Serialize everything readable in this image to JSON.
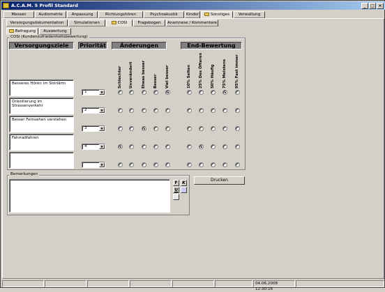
{
  "window": {
    "title": "A.C.A.M. 5 Profil Standard"
  },
  "main_tabs": [
    {
      "label": "Messen"
    },
    {
      "label": "Audiometrie"
    },
    {
      "label": "Anpassung"
    },
    {
      "label": "Richtungshören"
    },
    {
      "label": "Psychoakustik"
    },
    {
      "label": "Kinder"
    },
    {
      "label": "Sonstiges"
    },
    {
      "label": "Verwaltung"
    }
  ],
  "sub_tabs": [
    {
      "label": "Versorgungsdokumentation"
    },
    {
      "label": "Simulationen"
    },
    {
      "label": "COSI"
    },
    {
      "label": "Fragebogen"
    },
    {
      "label": "Anamnese / Kommentare"
    }
  ],
  "inner_tabs": [
    {
      "label": "Befragung"
    },
    {
      "label": "Auswertung"
    }
  ],
  "cosi": {
    "group_title": "COSI (Kundenzufriedenheitsbewertung)",
    "headers": {
      "goals": "Versorgungsziele",
      "priority": "Priorität",
      "changes": "Änderungen",
      "end": "End-Bewertung"
    },
    "change_columns": [
      "Schlechter",
      "Unverändert",
      "Etwas besser",
      "Besser",
      "Viel besser"
    ],
    "end_columns": [
      "10% Selten",
      "25% Des Öfteren",
      "50% Häufig",
      "75% Meistens",
      "95% Fast immer"
    ],
    "rows": [
      {
        "goal": "Besseres Hören im Störlärm",
        "priority": "1",
        "change": 4,
        "end": 3
      },
      {
        "goal": "Orientierung im Strassenverkehr",
        "priority": "2",
        "change": -1,
        "end": -1
      },
      {
        "goal": "Besser Fernsehen verstehen",
        "priority": "3",
        "change": 2,
        "end": -1
      },
      {
        "goal": "Fahrradfahren",
        "priority": "4",
        "change": 0,
        "end": 1
      },
      {
        "goal": "",
        "priority": "",
        "change": -1,
        "end": -1
      }
    ]
  },
  "remarks": {
    "label": "Bemerkungen",
    "text": "",
    "format_buttons": [
      "F",
      "K",
      "U"
    ]
  },
  "print_button": "Drucken",
  "status": {
    "datetime": "04.06.2008 12:30:16"
  }
}
